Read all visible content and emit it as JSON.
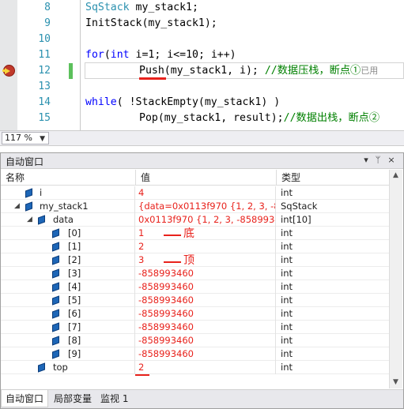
{
  "editor": {
    "lines": [
      {
        "num": "8"
      },
      {
        "num": "9"
      },
      {
        "num": "10"
      },
      {
        "num": "11"
      },
      {
        "num": "12"
      },
      {
        "num": "13"
      },
      {
        "num": "14"
      },
      {
        "num": "15"
      }
    ],
    "code": {
      "l8_type": "SqStack",
      "l8_rest": " my_stack1;",
      "l9": "InitStack(my_stack1);",
      "l11_kw1": "for",
      "l11_p1": "(",
      "l11_kw2": "int",
      "l11_rest": " i=1; i<=10; i++)",
      "l12_fn": "Push",
      "l12_rest": "(my_stack1, i); ",
      "l12_comment": "//数据压栈，断点①",
      "l12_hint": "已用",
      "l14_kw": "while",
      "l14_rest": "( !StackEmpty(my_stack1) )",
      "l15_rest": "Pop(my_stack1, result);",
      "l15_comment": "//数据出栈，断点②"
    },
    "zoom": "117 %"
  },
  "autos": {
    "title": "自动窗口",
    "title_buttons": [
      "▾",
      "ᛘ",
      "×"
    ],
    "columns": {
      "name": "名称",
      "value": "值",
      "type": "类型"
    },
    "rows": [
      {
        "name": "i",
        "value": "4",
        "type": "int"
      },
      {
        "name": "my_stack1",
        "value": "{data=0x0113f970 {1, 2, 3, -8589...",
        "type": "SqStack"
      },
      {
        "name": "data",
        "value": "0x0113f970 {1, 2, 3, -858993460, ...",
        "type": "int[10]"
      },
      {
        "name": "[0]",
        "value": "1",
        "type": "int"
      },
      {
        "name": "[1]",
        "value": "2",
        "type": "int"
      },
      {
        "name": "[2]",
        "value": "3",
        "type": "int"
      },
      {
        "name": "[3]",
        "value": "-858993460",
        "type": "int"
      },
      {
        "name": "[4]",
        "value": "-858993460",
        "type": "int"
      },
      {
        "name": "[5]",
        "value": "-858993460",
        "type": "int"
      },
      {
        "name": "[6]",
        "value": "-858993460",
        "type": "int"
      },
      {
        "name": "[7]",
        "value": "-858993460",
        "type": "int"
      },
      {
        "name": "[8]",
        "value": "-858993460",
        "type": "int"
      },
      {
        "name": "[9]",
        "value": "-858993460",
        "type": "int"
      },
      {
        "name": "top",
        "value": "2",
        "type": "int"
      }
    ],
    "annotations": {
      "bottom": "底",
      "top": "顶"
    },
    "tabs": [
      "自动窗口",
      "局部变量",
      "监视 1"
    ]
  },
  "colors": {
    "value_red": "#e8221c",
    "icon_blue": "#1d66b7",
    "keyword": "#0000ff",
    "type": "#2b91af",
    "comment": "#008000"
  }
}
